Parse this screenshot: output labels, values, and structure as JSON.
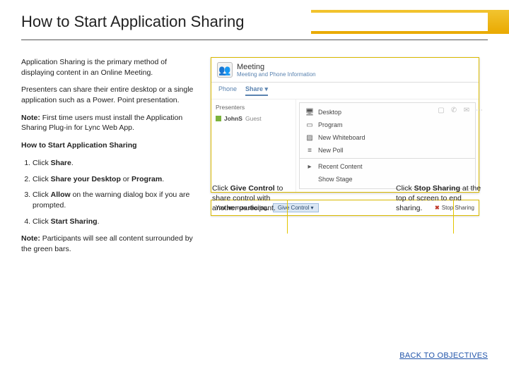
{
  "header": {
    "title": "How to Start Application Sharing"
  },
  "body": {
    "p1": "Application Sharing is the primary method of displaying content in an Online Meeting.",
    "p2": "Presenters can share their entire desktop or a single application such as a Power. Point presentation.",
    "note1_label": "Note:",
    "note1_text": " First time users must install the Application Sharing Plug-in for Lync Web App.",
    "subhead": "How to Start Application Sharing",
    "steps": {
      "s1a": "Click ",
      "s1b": "Share",
      "s1c": ".",
      "s2a": "Click ",
      "s2b": "Share your Desktop",
      "s2c": " or ",
      "s2d": "Program",
      "s2e": ".",
      "s3a": "Click ",
      "s3b": "Allow",
      "s3c": " on the warning dialog box if you are prompted.",
      "s4a": "Click ",
      "s4b": "Start Sharing",
      "s4c": "."
    },
    "note2_label": "Note:",
    "note2_text": " Participants will see all content surrounded by the green bars."
  },
  "shot1": {
    "meeting_title": "Meeting",
    "meeting_sub": "Meeting and Phone Information",
    "tab_phone": "Phone",
    "tab_share": "Share ▾",
    "presenters_hdr": "Presenters",
    "presenter1": "JohnS",
    "presenter1_tag": "Guest",
    "menu": {
      "desktop": "Desktop",
      "program": "Program",
      "whiteboard": "New Whiteboard",
      "poll": "New Poll",
      "recent": "Recent Content",
      "stage": "Show Stage"
    }
  },
  "shot2": {
    "now_sharing": "You are now sharing.",
    "give_control": "Give Control ▾",
    "stop_sharing": "Stop Sharing"
  },
  "callouts": {
    "c1a": "Click ",
    "c1b": "Give Control",
    "c1c": " to share control with another participant.",
    "c2a": "Click ",
    "c2b": "Stop Sharing",
    "c2c": " at the top of screen to end sharing."
  },
  "footer": {
    "back": "BACK TO OBJECTIVES"
  }
}
